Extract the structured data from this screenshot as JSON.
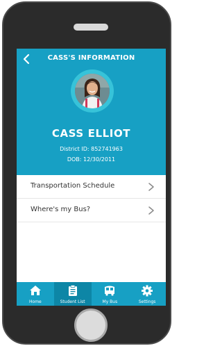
{
  "header": {
    "title": "CASS'S INFORMATION"
  },
  "student": {
    "name": "CASS ELLIOT",
    "district_id": "District ID: 852741963",
    "dob": "DOB: 12/30/2011"
  },
  "menu": {
    "items": [
      {
        "label": "Transportation Schedule",
        "icon": "chevron-right-icon"
      },
      {
        "label": "Where's my Bus?",
        "icon": "chevron-right-icon"
      }
    ]
  },
  "tabbar": {
    "active": "Student List",
    "tabs": [
      {
        "label": "Home",
        "icon": "home-icon"
      },
      {
        "label": "Student List",
        "icon": "clipboard-icon"
      },
      {
        "label": "My Bus",
        "icon": "bus-icon"
      },
      {
        "label": "Settings",
        "icon": "gear-icon"
      }
    ]
  },
  "colors": {
    "primary": "#17a0c4",
    "active_tab": "#0d86a6",
    "avatar_ring": "#37c3d9",
    "device": "#2b2b2b"
  }
}
